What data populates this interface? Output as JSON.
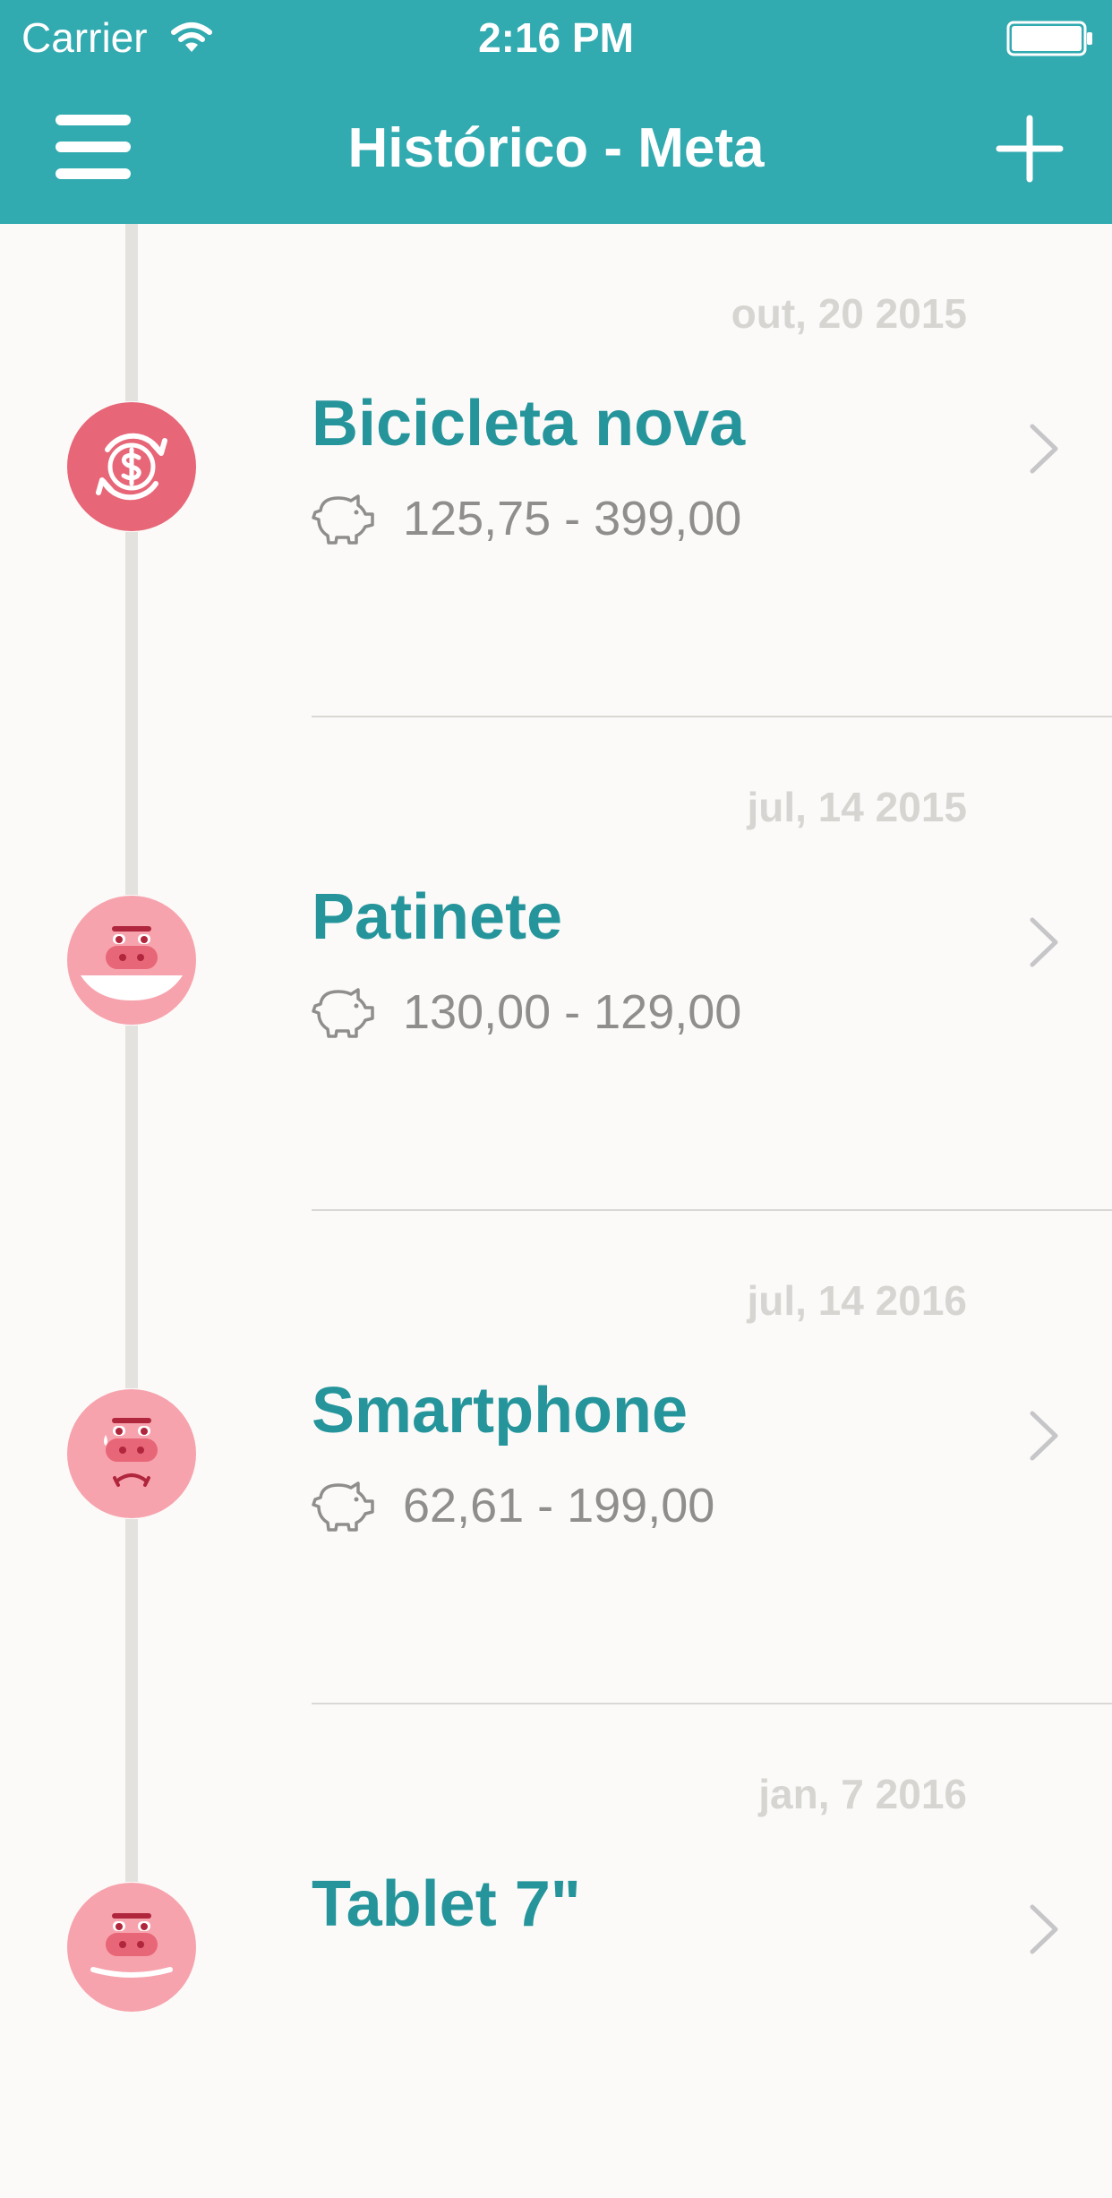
{
  "status_bar": {
    "carrier": "Carrier",
    "time": "2:16 PM"
  },
  "nav": {
    "title": "Histórico - Meta",
    "menu_icon": "hamburger-menu-icon",
    "add_icon": "plus-icon"
  },
  "colors": {
    "header": "#31aab0",
    "title_text": "#25959b",
    "avatar_pink": "#f7a3ad",
    "avatar_red": "#e76677"
  },
  "goals": [
    {
      "date": "out, 20 2015",
      "name": "Bicicleta nova",
      "amounts": "125,75 - 399,00",
      "status_icon": "money-exchange-icon"
    },
    {
      "date": "jul, 14 2015",
      "name": "Patinete",
      "amounts": "130,00 - 129,00",
      "status_icon": "happy-pig-icon"
    },
    {
      "date": "jul, 14 2016",
      "name": "Smartphone",
      "amounts": "62,61 - 199,00",
      "status_icon": "sad-pig-icon"
    },
    {
      "date": "jan, 7 2016",
      "name": "Tablet 7\"",
      "amounts": "",
      "status_icon": "neutral-pig-icon"
    }
  ]
}
